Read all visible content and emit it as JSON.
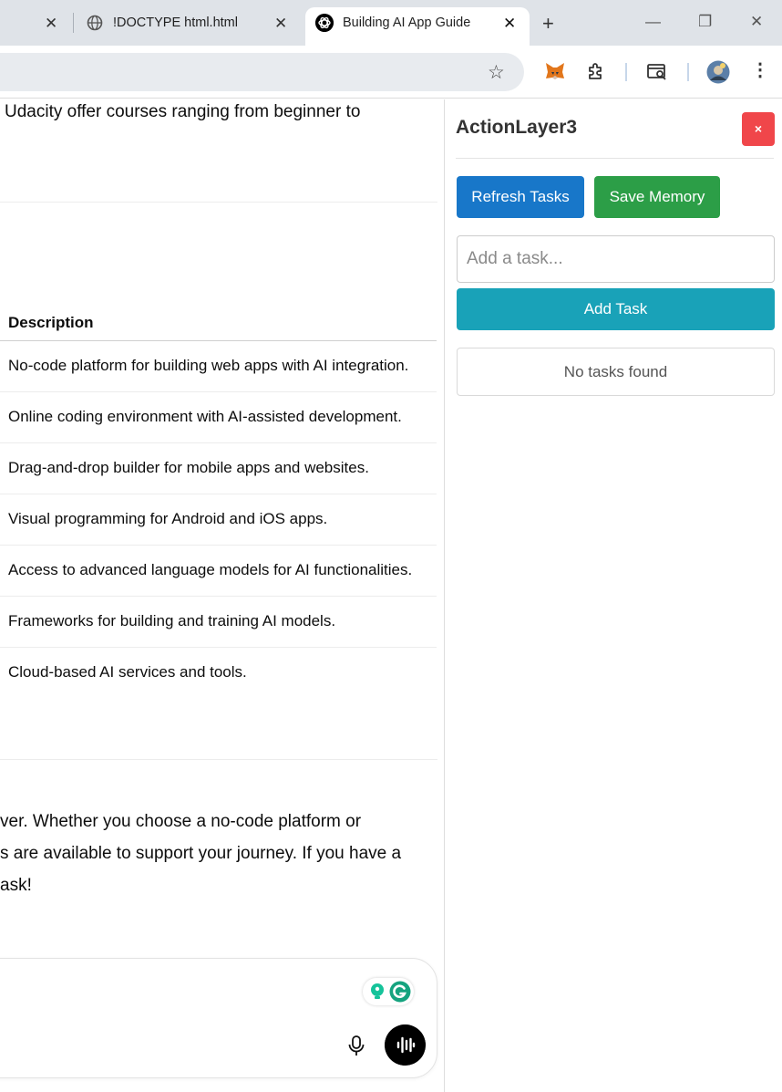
{
  "browser": {
    "tabs": [
      {
        "title": ""
      },
      {
        "title": "!DOCTYPE html.html",
        "icon": "globe-icon"
      },
      {
        "title": "Building AI App Guide",
        "icon": "chatgpt-icon",
        "active": true
      }
    ],
    "tab_close_glyph": "✕",
    "new_tab_glyph": "+",
    "window_controls": {
      "minimize": "—",
      "restore": "❐",
      "close": "✕"
    },
    "toolbar_icons": [
      "bookmark-star-icon",
      "metamask-fox-icon",
      "extensions-puzzle-icon",
      "tab-search-icon",
      "profile-avatar-icon",
      "more-menu-icon"
    ]
  },
  "page": {
    "intro_fragment": "Udacity offer courses ranging from beginner to",
    "table": {
      "header": "Description",
      "rows": [
        "No-code platform for building web apps with AI integration.",
        "Online coding environment with AI-assisted development.",
        "Drag-and-drop builder for mobile apps and websites.",
        "Visual programming for Android and iOS apps.",
        "Access to advanced language models for AI functionalities.",
        "Frameworks for building and training AI models.",
        "Cloud-based AI services and tools."
      ]
    },
    "conclusion_lines": [
      "ver. Whether you choose a no-code platform or",
      "s are available to support your journey. If you have a",
      " ask!"
    ],
    "composer": {
      "icons": [
        "grammarly-icon",
        "microphone-icon",
        "voice-mode-icon"
      ]
    },
    "footer_fragment": ""
  },
  "panel": {
    "title": "ActionLayer3",
    "close_label": "×",
    "refresh_label": "Refresh Tasks",
    "save_label": "Save Memory",
    "task_placeholder": "Add a task...",
    "add_label": "Add Task",
    "empty_message": "No tasks found",
    "colors": {
      "close": "#f0464a",
      "refresh": "#1877c9",
      "save": "#2c9e47",
      "add": "#19a2b8"
    }
  }
}
